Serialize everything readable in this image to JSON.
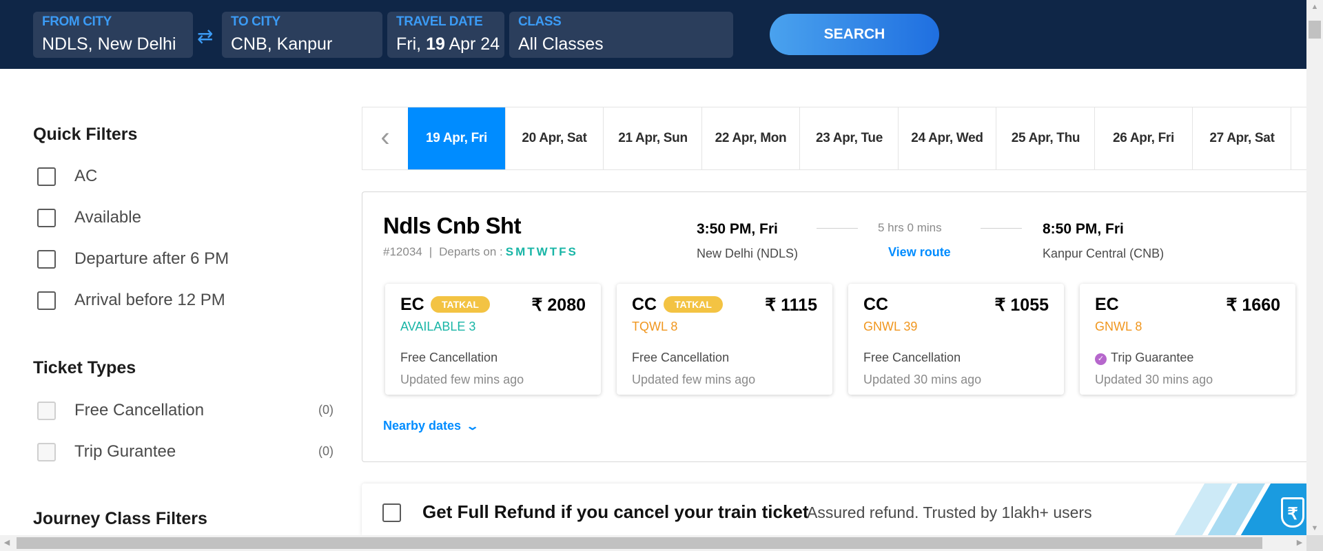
{
  "search": {
    "from": {
      "label": "FROM CITY",
      "value": "NDLS, New Delhi"
    },
    "to": {
      "label": "TO CITY",
      "value": "CNB, Kanpur"
    },
    "date": {
      "label": "TRAVEL DATE",
      "prefix": "Fri,",
      "day": "19",
      "suffix": "Apr 24"
    },
    "class": {
      "label": "CLASS",
      "value": "All Classes"
    },
    "swap_icon": "⇄",
    "search_label": "SEARCH"
  },
  "sidebar": {
    "quick_filters_title": "Quick Filters",
    "quick_filters": [
      "AC",
      "Available",
      "Departure after 6 PM",
      "Arrival before 12 PM"
    ],
    "ticket_types_title": "Ticket Types",
    "ticket_types": [
      {
        "label": "Free Cancellation",
        "count": "(0)"
      },
      {
        "label": "Trip Gurantee",
        "count": "(0)"
      }
    ],
    "journey_class_title": "Journey Class Filters"
  },
  "dates": [
    "19 Apr, Fri",
    "20 Apr, Sat",
    "21 Apr, Sun",
    "22 Apr, Mon",
    "23 Apr, Tue",
    "24 Apr, Wed",
    "25 Apr, Thu",
    "26 Apr, Fri",
    "27 Apr, Sat"
  ],
  "train": {
    "name": "Ndls Cnb Sht",
    "number": "#12034",
    "separator": "|",
    "departs_on_label": "Departs on :",
    "days": "SMTWTFS",
    "dep_time": "3:50 PM, Fri",
    "dep_station": "New Delhi (NDLS)",
    "duration": "5 hrs 0 mins",
    "view_route": "View route",
    "arr_time": "8:50 PM, Fri",
    "arr_station": "Kanpur Central (CNB)",
    "classes": [
      {
        "name": "EC",
        "tag": "TATKAL",
        "price": "₹ 2080",
        "availability": "AVAILABLE 3",
        "availability_color": "green",
        "feature": "Free Cancellation",
        "updated": "Updated few mins ago"
      },
      {
        "name": "CC",
        "tag": "TATKAL",
        "price": "₹ 1115",
        "availability": "TQWL 8",
        "availability_color": "orange",
        "feature": "Free Cancellation",
        "updated": "Updated few mins ago"
      },
      {
        "name": "CC",
        "tag": "",
        "price": "₹ 1055",
        "availability": "GNWL 39",
        "availability_color": "orange",
        "feature": "Free Cancellation",
        "updated": "Updated 30 mins ago"
      },
      {
        "name": "EC",
        "tag": "",
        "price": "₹ 1660",
        "availability": "GNWL 8",
        "availability_color": "orange",
        "feature": "Trip Guarantee",
        "updated": "Updated 30 mins ago"
      }
    ],
    "nearby_dates": "Nearby dates"
  },
  "refund": {
    "title": "Get Full Refund if you cancel your train ticket",
    "subtitle": "Assured refund. Trusted by 1lakh+ users",
    "shield_symbol": "₹"
  },
  "colors": {
    "header_bg": "#0f2647",
    "accent_blue": "#008cff",
    "available_green": "#18b5a6",
    "waitlist_orange": "#f0961e",
    "tatkal_yellow": "#f3c343",
    "guarantee_purple": "#b667cc"
  }
}
